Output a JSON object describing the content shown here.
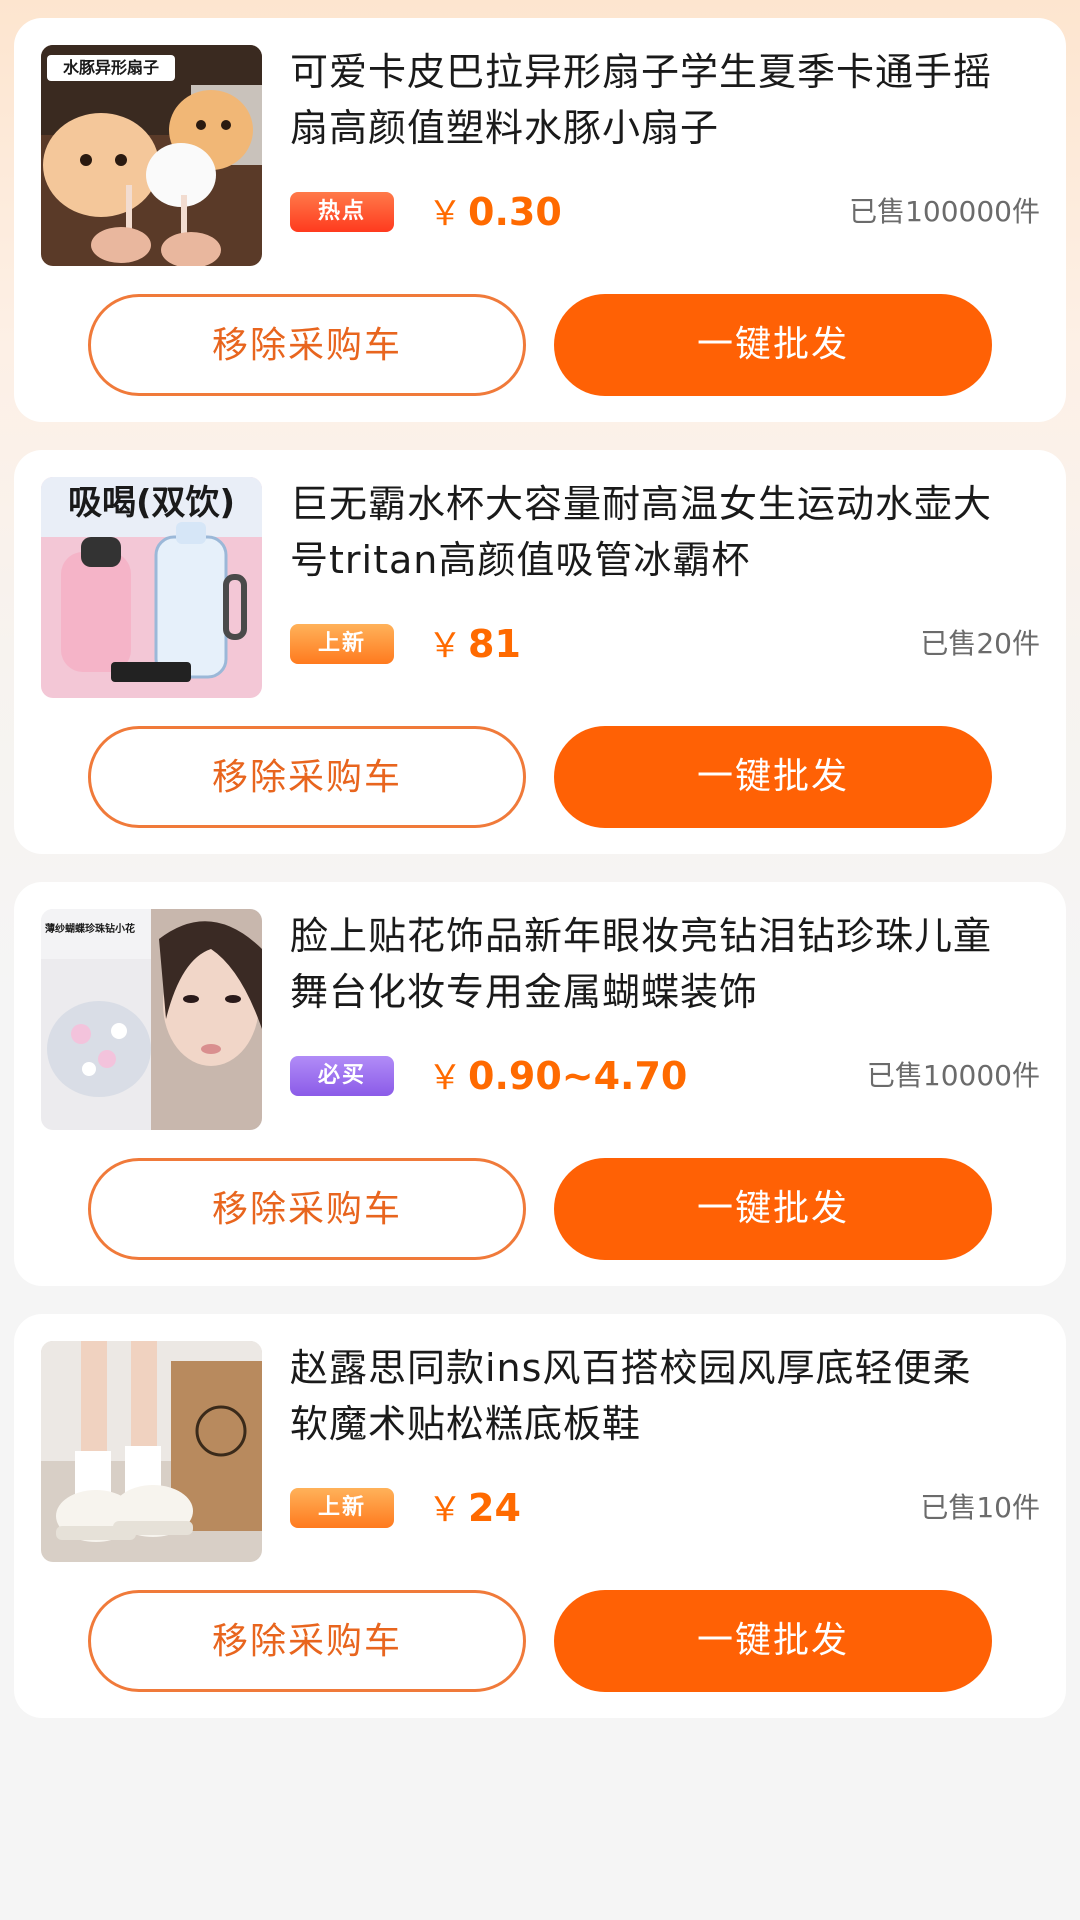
{
  "items": [
    {
      "title": "可爱卡皮巴拉异形扇子学生夏季卡通手摇扇高颜值塑料水豚小扇子",
      "tag": "热点",
      "tag_color": "#ff4d2e",
      "price_symbol": "￥",
      "price": "0.30",
      "sold": "已售100000件",
      "image_text": "水豚异形扇子",
      "remove_label": "移除采购车",
      "buy_label": "一键批发"
    },
    {
      "title": "巨无霸水杯大容量耐高温女生运动水壶大号tritan高颜值吸管冰霸杯",
      "tag": "上新",
      "tag_color": "#ff8c2a",
      "price_symbol": "￥",
      "price": "81",
      "sold": "已售20件",
      "image_text": "吸喝(双饮)",
      "remove_label": "移除采购车",
      "buy_label": "一键批发"
    },
    {
      "title": "脸上贴花饰品新年眼妆亮钻泪钻珍珠儿童舞台化妆专用金属蝴蝶装饰",
      "tag": "必买",
      "tag_color": "#9b6bf0",
      "price_symbol": "￥",
      "price": "0.90~4.70",
      "sold": "已售10000件",
      "image_text": "薄纱蝴蝶珍珠钻小花",
      "remove_label": "移除采购车",
      "buy_label": "一键批发"
    },
    {
      "title": "赵露思同款ins风百搭校园风厚底轻便柔软魔术贴松糕底板鞋",
      "tag": "上新",
      "tag_color": "#ff8c2a",
      "price_symbol": "￥",
      "price": "24",
      "sold": "已售10件",
      "image_text": "",
      "remove_label": "移除采购车",
      "buy_label": "一键批发"
    }
  ],
  "colors": {
    "accent": "#ff6105",
    "price": "#ff6a00"
  }
}
